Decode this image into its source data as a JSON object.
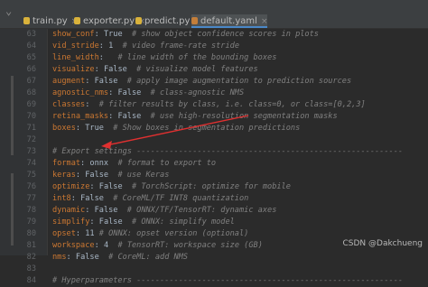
{
  "tabs": [
    {
      "label": "train.py",
      "color": "#d9b23b",
      "active": false
    },
    {
      "label": "exporter.py",
      "color": "#d9b23b",
      "active": false
    },
    {
      "label": "predict.py",
      "color": "#d9b23b",
      "active": false
    },
    {
      "label": "default.yaml",
      "color": "#c37e3a",
      "active": true
    }
  ],
  "lines": [
    {
      "n": "63",
      "key": "show_conf",
      "val": " True",
      "com": "  # show object confidence scores in plots"
    },
    {
      "n": "64",
      "key": "vid_stride",
      "val": " 1",
      "com": "  # video frame-rate stride"
    },
    {
      "n": "65",
      "key": "line_width",
      "val": "",
      "com": "   # line width of the bounding boxes"
    },
    {
      "n": "66",
      "key": "visualize",
      "val": " False",
      "com": "  # visualize model features"
    },
    {
      "n": "67",
      "key": "augment",
      "val": " False",
      "com": "  # apply image augmentation to prediction sources"
    },
    {
      "n": "68",
      "key": "agnostic_nms",
      "val": " False",
      "com": "  # class-agnostic NMS"
    },
    {
      "n": "69",
      "key": "classes",
      "val": "",
      "com": "  # filter results by class, i.e. class=0, or class=[0,2,3]"
    },
    {
      "n": "70",
      "key": "retina_masks",
      "val": " False",
      "com": "  # use high-resolution segmentation masks"
    },
    {
      "n": "71",
      "key": "boxes",
      "val": " True",
      "com": "  # Show boxes in segmentation predictions"
    },
    {
      "n": "72",
      "key": "",
      "val": "",
      "com": ""
    },
    {
      "n": "73",
      "key": "",
      "val": "",
      "com": "# Export settings ---------------------------------------------------------"
    },
    {
      "n": "74",
      "key": "format",
      "val": " onnx",
      "com": "  # format to export to"
    },
    {
      "n": "75",
      "key": "keras",
      "val": " False",
      "com": "  # use Keras"
    },
    {
      "n": "76",
      "key": "optimize",
      "val": " False",
      "com": "  # TorchScript: optimize for mobile"
    },
    {
      "n": "77",
      "key": "int8",
      "val": " False",
      "com": "  # CoreML/TF INT8 quantization"
    },
    {
      "n": "78",
      "key": "dynamic",
      "val": " False",
      "com": "  # ONNX/TF/TensorRT: dynamic axes"
    },
    {
      "n": "79",
      "key": "simplify",
      "val": " False",
      "com": "  # ONNX: simplify model"
    },
    {
      "n": "80",
      "key": "opset",
      "val": " 11",
      "com": " # ONNX: opset version (optional)"
    },
    {
      "n": "81",
      "key": "workspace",
      "val": " 4",
      "com": "  # TensorRT: workspace size (GB)"
    },
    {
      "n": "82",
      "key": "nms",
      "val": " False",
      "com": "  # CoreML: add NMS"
    },
    {
      "n": "83",
      "key": "",
      "val": "",
      "com": ""
    },
    {
      "n": "84",
      "key": "",
      "val": "",
      "com": "# Hyperparameters ---------------------------------------------------------"
    }
  ],
  "watermark": "CSDN @Dakchueng",
  "colors": {
    "key": "#cc7832",
    "comment": "#808080",
    "text": "#a9b7c6",
    "arrow": "#e03030"
  }
}
